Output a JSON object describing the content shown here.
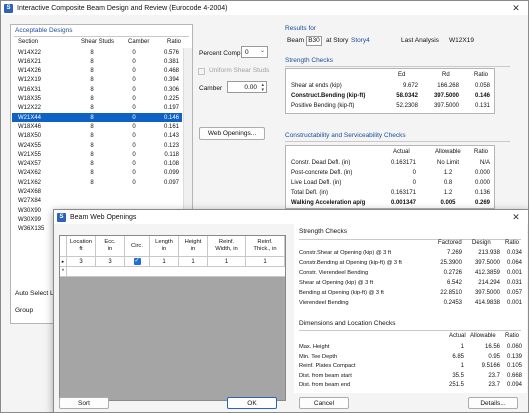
{
  "main": {
    "title": "Interactive Composite Beam Design and Review (Eurocode 4-2004)",
    "acceptable_designs": "Acceptable Designs",
    "columns": [
      "Section",
      "Shear Studs",
      "Camber",
      "Ratio"
    ],
    "rows": [
      [
        "W14X22",
        "8",
        "0",
        "0.576"
      ],
      [
        "W16X21",
        "8",
        "0",
        "0.381"
      ],
      [
        "W14X26",
        "8",
        "0",
        "0.468"
      ],
      [
        "W12X19",
        "8",
        "0",
        "0.394"
      ],
      [
        "W16X31",
        "8",
        "0",
        "0.306"
      ],
      [
        "W18X35",
        "8",
        "0",
        "0.225"
      ],
      [
        "W12X22",
        "8",
        "0",
        "0.197"
      ],
      [
        "W21X44",
        "8",
        "0",
        "0.146"
      ],
      [
        "W18X46",
        "8",
        "0",
        "0.161"
      ],
      [
        "W18X50",
        "8",
        "0",
        "0.143"
      ],
      [
        "W24X55",
        "8",
        "0",
        "0.123"
      ],
      [
        "W21X55",
        "8",
        "0",
        "0.118"
      ],
      [
        "W24X57",
        "8",
        "0",
        "0.108"
      ],
      [
        "W24X62",
        "8",
        "0",
        "0.099"
      ],
      [
        "W21X62",
        "8",
        "0",
        "0.097"
      ],
      [
        "W24X68",
        "",
        "",
        ""
      ],
      [
        "W27X84",
        "",
        "",
        ""
      ],
      [
        "W30X90",
        "",
        "",
        ""
      ],
      [
        "W30X99",
        "",
        "",
        ""
      ],
      [
        "W36X135",
        "",
        "",
        ""
      ]
    ],
    "selected_row": 7,
    "percent_comp_label": "Percent Comp.",
    "percent_comp_value": "0",
    "uniform_studs_label": "Uniform Shear Studs",
    "camber_label": "Camber",
    "camber_value": "0.00",
    "web_openings_btn": "Web Openings...",
    "auto_select_label": "Auto Select L",
    "group_label": "Group",
    "results_for": "Results for",
    "beam_label": "Beam",
    "beam_value": "B30",
    "at_story_label": "at Story",
    "story_value": "Story4",
    "last_analysis_label": "Last Analysis",
    "last_analysis_value": "W12X19",
    "strength_checks": "Strength Checks",
    "strength_cols": [
      "Ed",
      "Rd",
      "Ratio"
    ],
    "strength_rows": [
      [
        "Shear at ends (kip)",
        "9.672",
        "166.268",
        "0.058"
      ],
      [
        "Construct.Bending (kip-ft)",
        "58.0342",
        "397.5000",
        "0.146"
      ],
      [
        "Positive Bending (kip-ft)",
        "52.2308",
        "397.5000",
        "0.131"
      ]
    ],
    "constructability": "Constructability and Serviceability Checks",
    "serv_cols": [
      "Actual",
      "Allowable",
      "Ratio"
    ],
    "serv_rows": [
      [
        "Constr. Dead Defl. (in)",
        "0.163171",
        "No Limit",
        "N/A"
      ],
      [
        "Post-concrete Defl. (in)",
        "0",
        "1.2",
        "0.000"
      ],
      [
        "Live Load Defl. (in)",
        "0",
        "0.8",
        "0.000"
      ],
      [
        "Total Defl. (in)",
        "0.163171",
        "1.2",
        "0.136"
      ],
      [
        "Walking Acceleration ap/g",
        "0.001347",
        "0.005",
        "0.269"
      ]
    ]
  },
  "dialog": {
    "title": "Beam Web Openings",
    "grid_headers": [
      "Location\nft",
      "Ecc.\nin",
      "Circ.",
      "Length\nin",
      "Height\nin",
      "Reinf.\nWidth, in",
      "Reinf.\nThick., in"
    ],
    "grid_row": [
      "3",
      "3",
      "",
      "1",
      "1",
      "1",
      "1"
    ],
    "row_marker": "▸",
    "new_marker": "*",
    "strength_title": "Strength Checks",
    "strength_cols": [
      "Factored",
      "Design",
      "Ratio"
    ],
    "strength_rows": [
      [
        "Constr.Shear at Opening (kip) @ 3 ft",
        "7.269",
        "213.938",
        "0.034"
      ],
      [
        "Constr.Bending at Opening (kip-ft) @ 3 ft",
        "25.3900",
        "397.5000",
        "0.064"
      ],
      [
        "Constr. Vierendeel Bending",
        "0.2726",
        "412.3859",
        "0.001"
      ],
      [
        "Shear at Opening (kip) @ 3 ft",
        "6.542",
        "214.294",
        "0.031"
      ],
      [
        "Bending at Opening (kip-ft) @ 3 ft",
        "22.8510",
        "397.5000",
        "0.057"
      ],
      [
        "Vierendeel Bending",
        "0.2453",
        "414.9838",
        "0.001"
      ]
    ],
    "dims_title": "Dimensions and Location Checks",
    "dims_cols": [
      "Actual",
      "Allowable",
      "Ratio"
    ],
    "dims_rows": [
      [
        "Max. Height",
        "1",
        "16.56",
        "0.060"
      ],
      [
        "Min. Tee Depth",
        "6.85",
        "0.95",
        "0.139"
      ],
      [
        "Reinf. Plates Compact",
        "1",
        "9.5166",
        "0.105"
      ],
      [
        "Dist. from beam start",
        "35.5",
        "23.7",
        "0.668"
      ],
      [
        "Dist. from beam end",
        "251.5",
        "23.7",
        "0.094"
      ]
    ],
    "sort_btn": "Sort",
    "ok_btn": "OK",
    "cancel_btn": "Cancel",
    "details_btn": "Details..."
  }
}
